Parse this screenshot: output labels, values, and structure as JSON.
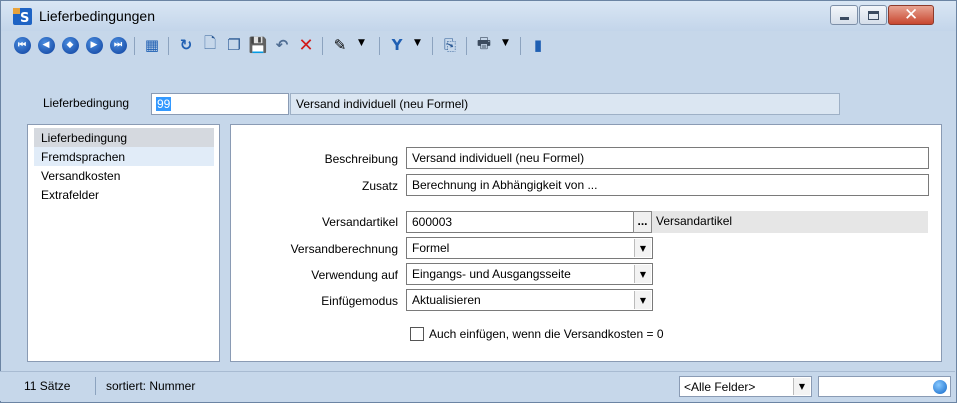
{
  "window": {
    "title": "Lieferbedingungen",
    "icon": "app-logo-icon",
    "controls": {
      "minimize": "minimize-icon",
      "maximize": "maximize-icon",
      "close": "✕"
    }
  },
  "toolbar": {
    "nav": [
      {
        "name": "first-record",
        "glyph": "⏮"
      },
      {
        "name": "previous-record",
        "glyph": "◀"
      },
      {
        "name": "select-record",
        "glyph": "◆"
      },
      {
        "name": "next-record",
        "glyph": "▶"
      },
      {
        "name": "last-record",
        "glyph": "⏭"
      }
    ],
    "tools": [
      {
        "name": "table-view",
        "glyph": "▦",
        "color": "#1f5fb3"
      },
      {
        "name": "refresh",
        "glyph": "↻",
        "color": "#1f5fb3"
      },
      {
        "name": "new-document",
        "glyph": "🗋",
        "color": "#2e5c96"
      },
      {
        "name": "copy",
        "glyph": "❐",
        "color": "#2e5c96"
      },
      {
        "name": "save",
        "glyph": "💾",
        "color": "#5d6f85"
      },
      {
        "name": "undo",
        "glyph": "↶",
        "color": "#4f6d93"
      },
      {
        "name": "delete",
        "glyph": "✕",
        "color": "#d11a1a"
      },
      {
        "name": "marker",
        "glyph": "✎",
        "color": "#1b1b1b"
      },
      {
        "name": "filter",
        "glyph": "Y",
        "color": "#1f5fb3"
      },
      {
        "name": "pointer-document",
        "glyph": "⎘",
        "color": "#2e5c96"
      },
      {
        "name": "printer",
        "glyph": "🖶",
        "color": "#3c4b5f"
      },
      {
        "name": "exit-door",
        "glyph": "▮",
        "color": "#1f5fb3"
      }
    ],
    "dropdown_arrow": "▼"
  },
  "header": {
    "label": "Lieferbedingung",
    "code": "99",
    "description": "Versand individuell (neu Formel)"
  },
  "sidebar": {
    "items": [
      {
        "label": "Lieferbedingung",
        "state": "selected"
      },
      {
        "label": "Fremdsprachen",
        "state": "hover"
      },
      {
        "label": "Versandkosten",
        "state": ""
      },
      {
        "label": "Extrafelder",
        "state": ""
      }
    ]
  },
  "form": {
    "beschreibung_label": "Beschreibung",
    "beschreibung_value": "Versand individuell (neu Formel)",
    "zusatz_label": "Zusatz",
    "zusatz_value": "Berechnung in Abhängigkeit von ...",
    "versandartikel_label": "Versandartikel",
    "versandartikel_value": "600003",
    "versandartikel_button": "...",
    "versandartikel_ref": "Versandartikel",
    "versandberechnung_label": "Versandberechnung",
    "versandberechnung_value": "Formel",
    "verwendung_label": "Verwendung auf",
    "verwendung_value": "Eingangs- und Ausgangsseite",
    "einfuegemodus_label": "Einfügemodus",
    "einfuegemodus_value": "Aktualisieren",
    "checkbox_label": "Auch einfügen, wenn die Versandkosten = 0",
    "checkbox_checked": false
  },
  "statusbar": {
    "count": "11 Sätze",
    "sort": "sortiert: Nummer",
    "field_filter": "<Alle Felder>",
    "search_value": ""
  }
}
